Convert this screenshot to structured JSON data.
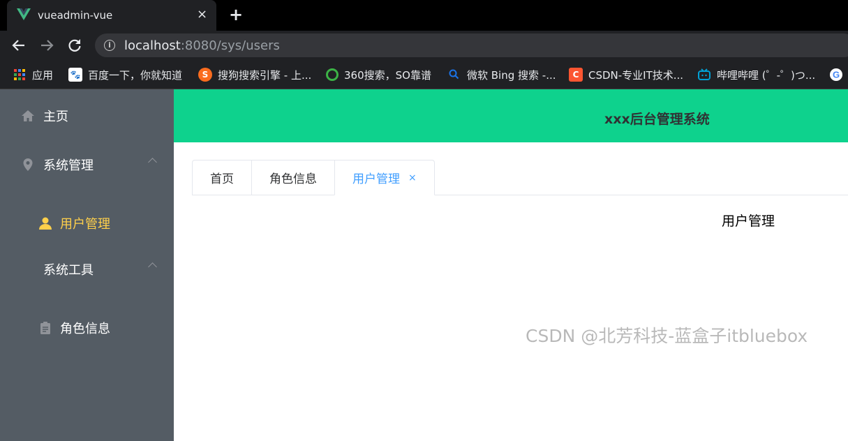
{
  "browser": {
    "tab_title": "vueadmin-vue",
    "tab_close": "×",
    "new_tab": "+",
    "url_host": "localhost",
    "url_rest": ":8080/sys/users"
  },
  "bookmarks": [
    {
      "label": "应用",
      "icon": "apps-grid-icon",
      "color": "#ea4335"
    },
    {
      "label": "百度一下，你就知道",
      "icon": "baidu-paw-icon",
      "color": "#2932e1"
    },
    {
      "label": "搜狗搜索引擎 - 上...",
      "icon": "sogou-icon",
      "color": "#fa6c1e"
    },
    {
      "label": "360搜索，SO靠谱",
      "icon": "360-icon",
      "color": "#3cb346"
    },
    {
      "label": "微软 Bing 搜索 -...",
      "icon": "search-icon",
      "color": "#1a73e8"
    },
    {
      "label": "CSDN-专业IT技术...",
      "icon": "csdn-icon",
      "color": "#fc5531"
    },
    {
      "label": "哔哩哔哩 (゜-゜)つ...",
      "icon": "bilibili-icon",
      "color": "#00a1d6"
    },
    {
      "label": "",
      "icon": "google-icon",
      "color": "#ffffff"
    }
  ],
  "sidebar": {
    "items": [
      {
        "label": "主页",
        "icon": "home-icon"
      },
      {
        "label": "系统管理",
        "icon": "location-icon"
      },
      {
        "label": "用户管理",
        "icon": "user-icon"
      },
      {
        "label": "系统工具",
        "icon": ""
      },
      {
        "label": "角色信息",
        "icon": "document-icon"
      }
    ],
    "active_color": "#ffd04b"
  },
  "header": {
    "title": "xxx后台管理系统",
    "color": "#0ed28d"
  },
  "tabs": [
    {
      "label": "首页"
    },
    {
      "label": "角色信息"
    },
    {
      "label": "用户管理",
      "closable": true,
      "close": "×"
    }
  ],
  "content": {
    "text": "用户管理"
  },
  "watermark": "CSDN @北芳科技-蓝盒子itbluebox"
}
